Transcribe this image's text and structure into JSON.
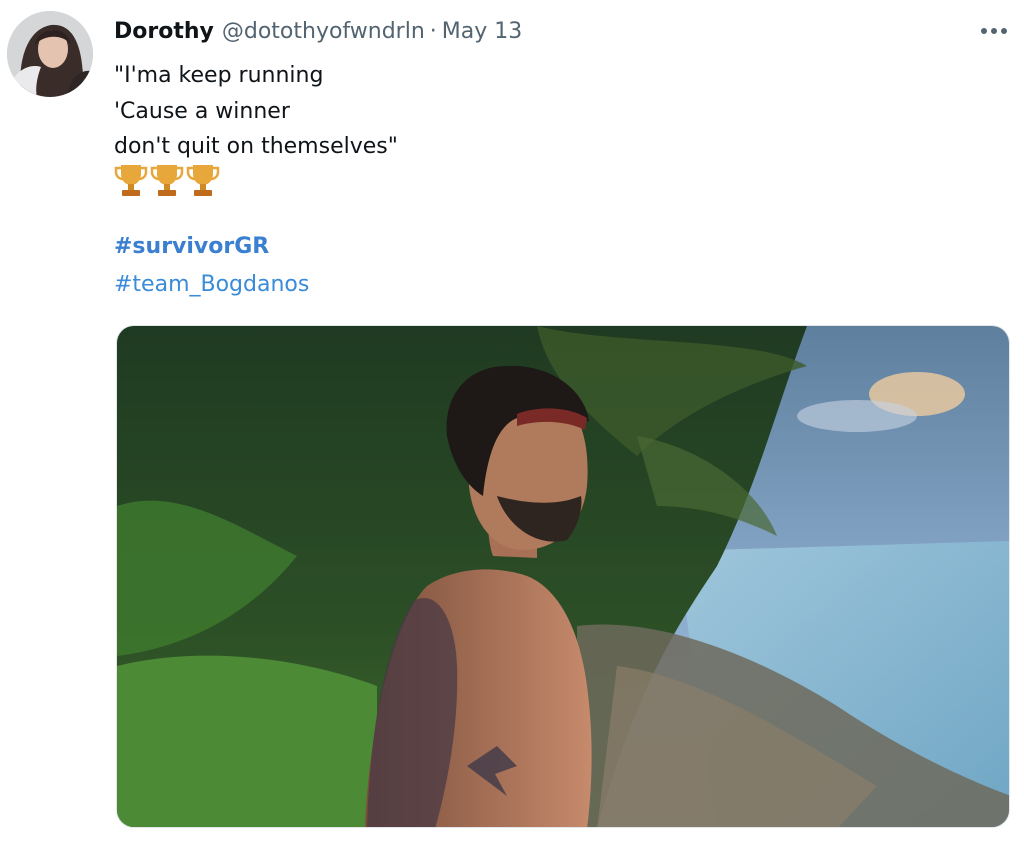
{
  "tweet": {
    "author_name": "Dorothy",
    "author_handle": "@dotothyofwndrln",
    "separator": "·",
    "date": "May 13",
    "lines": [
      "\"I'ma keep running",
      "'Cause a winner",
      "don't quit on themselves\""
    ],
    "emoji": [
      "🏆",
      "🏆",
      "🏆"
    ],
    "hashtags": [
      "#survivorGR",
      "#team_Bogdanos"
    ]
  },
  "icons": {
    "more": "more-horizontal-icon",
    "trophy": "trophy-icon"
  },
  "colors": {
    "text": "#0f1419",
    "secondary": "#536471",
    "link": "#1d9bf0",
    "trophy_gold": "#e8a73a"
  }
}
